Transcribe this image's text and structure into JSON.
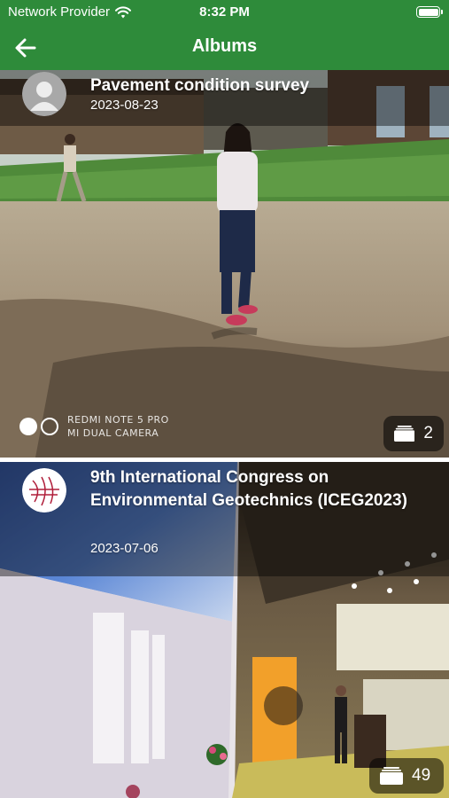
{
  "status_bar": {
    "carrier": "Network Provider",
    "time": "8:32 PM",
    "icons": [
      "wifi-icon",
      "battery-icon"
    ]
  },
  "app_bar": {
    "title": "Albums",
    "back_icon": "arrow-left-icon"
  },
  "colors": {
    "primary_green": "#2e8b3a"
  },
  "albums": [
    {
      "title": "Pavement condition survey",
      "date": "2023-08-23",
      "photo_count": "2",
      "avatar": "default-user-avatar",
      "photo_watermark": [
        "REDMI NOTE 5 PRO",
        "MI DUAL CAMERA"
      ]
    },
    {
      "title": "9th International Congress on Environmental Geotechnics (ICEG2023)",
      "date": "2023-07-06",
      "photo_count": "49",
      "avatar": "conference-logo-avatar"
    }
  ]
}
